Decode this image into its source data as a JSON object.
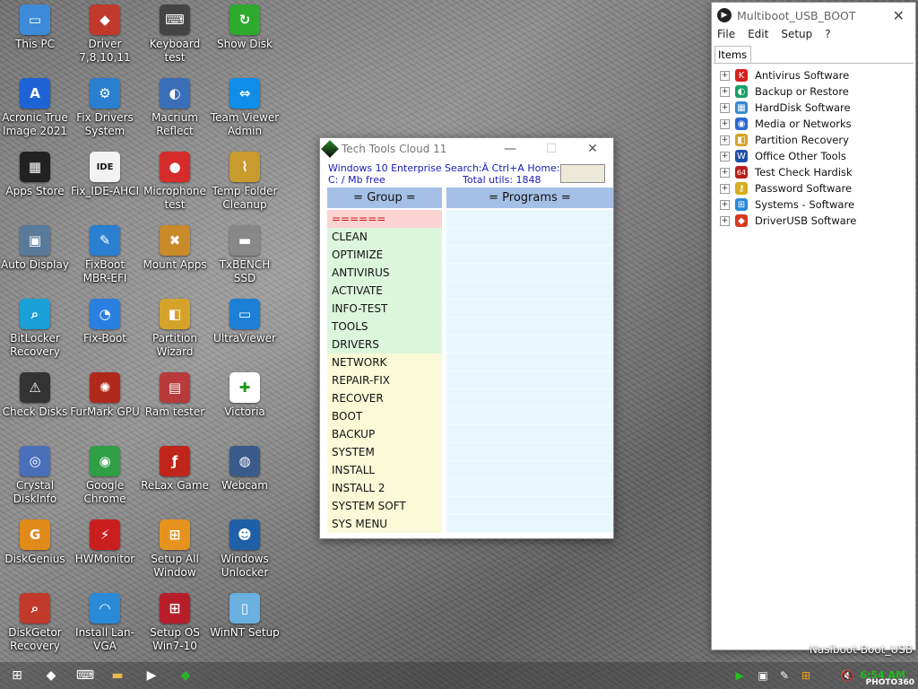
{
  "desktop": {
    "icons": [
      {
        "label": "This PC",
        "icon": "monitor-icon",
        "color": "#3d8bd8",
        "glyph": "▭"
      },
      {
        "label": "Driver 7,8,10,11",
        "icon": "driver-icon",
        "color": "#c0392b",
        "glyph": "◆"
      },
      {
        "label": "Keyboard test",
        "icon": "keyboard-icon",
        "color": "#444444",
        "glyph": "⌨"
      },
      {
        "label": "Show Disk",
        "icon": "refresh-icon",
        "color": "#2eaa2e",
        "glyph": "↻"
      },
      {
        "label": "Acronic True Image 2021",
        "icon": "acronis-icon",
        "color": "#1e63d6",
        "glyph": "A"
      },
      {
        "label": "Fix Drivers System",
        "icon": "gear-icon",
        "color": "#2a7fd0",
        "glyph": "⚙"
      },
      {
        "label": "Macrium Reflect",
        "icon": "macrium-icon",
        "color": "#3a6fb8",
        "glyph": "◐"
      },
      {
        "label": "Team Viewer Admin",
        "icon": "teamviewer-icon",
        "color": "#0e8ee9",
        "glyph": "⇔"
      },
      {
        "label": "Apps Store",
        "icon": "store-icon",
        "color": "#222222",
        "glyph": "▦"
      },
      {
        "label": "Fix_IDE-AHCI",
        "icon": "ahci-icon",
        "color": "#f2f2f2",
        "glyph": "IDE"
      },
      {
        "label": "Microphone test",
        "icon": "microphone-icon",
        "color": "#d62b2b",
        "glyph": "●"
      },
      {
        "label": "Temp Folder Cleanup",
        "icon": "broom-icon",
        "color": "#c99a2e",
        "glyph": "⌇"
      },
      {
        "label": "Auto Display",
        "icon": "display-icon",
        "color": "#5a7a9a",
        "glyph": "▣"
      },
      {
        "label": "FixBoot MBR-EFI",
        "icon": "wrench-icon",
        "color": "#2a7fd0",
        "glyph": "✎"
      },
      {
        "label": "Mount Apps",
        "icon": "tools-icon",
        "color": "#c98a2a",
        "glyph": "✖"
      },
      {
        "label": "TxBENCH SSD",
        "icon": "ssd-icon",
        "color": "#888888",
        "glyph": "▬"
      },
      {
        "label": "BitLocker Recovery",
        "icon": "magnifier-icon",
        "color": "#1aa0d6",
        "glyph": "⌕"
      },
      {
        "label": "Fix-Boot",
        "icon": "pie-icon",
        "color": "#2a7fe0",
        "glyph": "◔"
      },
      {
        "label": "Partition Wizard",
        "icon": "partition-icon",
        "color": "#d6a32a",
        "glyph": "◧"
      },
      {
        "label": "UltraViewer",
        "icon": "ultraviewer-icon",
        "color": "#1d7fd6",
        "glyph": "▭"
      },
      {
        "label": "Check Disks",
        "icon": "warning-disk-icon",
        "color": "#333333",
        "glyph": "⚠"
      },
      {
        "label": "FurMark GPU",
        "icon": "furmark-icon",
        "color": "#b0281b",
        "glyph": "✺"
      },
      {
        "label": "Ram tester",
        "icon": "ram-icon",
        "color": "#b83a3a",
        "glyph": "▤"
      },
      {
        "label": "Victoria",
        "icon": "green-cross-icon",
        "color": "#ffffff",
        "glyph": "✚"
      },
      {
        "label": "Crystal DiskInfo",
        "icon": "crystal-icon",
        "color": "#4a6fb8",
        "glyph": "◎"
      },
      {
        "label": "Google Chrome",
        "icon": "chrome-icon",
        "color": "#2f9e44",
        "glyph": "◉"
      },
      {
        "label": "ReLax Game",
        "icon": "flash-icon",
        "color": "#c0251b",
        "glyph": "ƒ"
      },
      {
        "label": "Webcam",
        "icon": "webcam-icon",
        "color": "#3a5a8a",
        "glyph": "◍"
      },
      {
        "label": "DiskGenius",
        "icon": "diskgenius-icon",
        "color": "#e08a1a",
        "glyph": "G"
      },
      {
        "label": "HWMonitor",
        "icon": "hwmonitor-icon",
        "color": "#c81e1e",
        "glyph": "⚡"
      },
      {
        "label": "Setup All Window",
        "icon": "windows-orange-icon",
        "color": "#e6931e",
        "glyph": "⊞"
      },
      {
        "label": "Windows Unlocker",
        "icon": "users-icon",
        "color": "#1e5fa8",
        "glyph": "☻"
      },
      {
        "label": "DiskGetor Recovery",
        "icon": "disk-search-icon",
        "color": "#c0392b",
        "glyph": "⌕"
      },
      {
        "label": "Install Lan-VGA",
        "icon": "wifi-icon",
        "color": "#2a8ad8",
        "glyph": "◠"
      },
      {
        "label": "Setup OS Win7-10",
        "icon": "windows-red-icon",
        "color": "#b81e2a",
        "glyph": "⊞"
      },
      {
        "label": "WinNT Setup",
        "icon": "winnt-icon",
        "color": "#6ab0e0",
        "glyph": "▯"
      }
    ]
  },
  "tech_tools": {
    "title": "Tech Tools Cloud 11",
    "minimize": "—",
    "maximize": "☐",
    "close": "✕",
    "os_line": "Windows 10 Enterprise",
    "drive_line": "C:  /  Mb  free",
    "search_line": "Search:Â Ctrl+A Home:",
    "total_line": "Total utils: 1848",
    "group_header": "= Group =",
    "programs_header": "= Programs  =",
    "groups": [
      {
        "label": "======",
        "bg": "#fbd3d3",
        "color": "#cc1111"
      },
      {
        "label": "CLEAN",
        "bg": "#dcf6dc",
        "color": "#111111"
      },
      {
        "label": "OPTIMIZE",
        "bg": "#dcf6dc",
        "color": "#111111"
      },
      {
        "label": "ANTIVIRUS",
        "bg": "#dcf6dc",
        "color": "#111111"
      },
      {
        "label": "ACTIVATE",
        "bg": "#dcf6dc",
        "color": "#111111"
      },
      {
        "label": "INFO-TEST",
        "bg": "#dcf6dc",
        "color": "#111111"
      },
      {
        "label": "TOOLS",
        "bg": "#dcf6dc",
        "color": "#111111"
      },
      {
        "label": "DRIVERS",
        "bg": "#dcf6dc",
        "color": "#111111"
      },
      {
        "label": "NETWORK",
        "bg": "#fbfad8",
        "color": "#111111"
      },
      {
        "label": "REPAIR-FIX",
        "bg": "#fbfad8",
        "color": "#111111"
      },
      {
        "label": "RECOVER",
        "bg": "#fbfad8",
        "color": "#111111"
      },
      {
        "label": "BOOT",
        "bg": "#fbfad8",
        "color": "#111111"
      },
      {
        "label": "BACKUP",
        "bg": "#fbfad8",
        "color": "#111111"
      },
      {
        "label": "SYSTEM",
        "bg": "#fbfad8",
        "color": "#111111"
      },
      {
        "label": "INSTALL",
        "bg": "#fbfad8",
        "color": "#111111"
      },
      {
        "label": "INSTALL 2",
        "bg": "#fbfad8",
        "color": "#111111"
      },
      {
        "label": "SYSTEM SOFT",
        "bg": "#fbfad8",
        "color": "#111111"
      },
      {
        "label": "SYS MENU",
        "bg": "#fbfad8",
        "color": "#111111"
      }
    ]
  },
  "multiboot": {
    "title": "Multiboot_USB_BOOT",
    "close": "✕",
    "menu": [
      "File",
      "Edit",
      "Setup",
      "?"
    ],
    "tab": "Items",
    "items": [
      {
        "label": "Antivirus Software",
        "icon": "antivirus-icon",
        "color": "#d61e1e",
        "glyph": "K"
      },
      {
        "label": "Backup or Restore",
        "icon": "backup-icon",
        "color": "#1aa06a",
        "glyph": "◐"
      },
      {
        "label": "HardDisk Software",
        "icon": "harddisk-icon",
        "color": "#3a8ad0",
        "glyph": "▦"
      },
      {
        "label": "Media or Networks",
        "icon": "network-icon",
        "color": "#2a6ad0",
        "glyph": "◉"
      },
      {
        "label": "Partition Recovery",
        "icon": "partition-recovery-icon",
        "color": "#d6a32a",
        "glyph": "◧"
      },
      {
        "label": "Office Other Tools",
        "icon": "word-icon",
        "color": "#1e4fa8",
        "glyph": "W"
      },
      {
        "label": "Test Check Hardisk",
        "icon": "aida64-icon",
        "color": "#b81e1e",
        "glyph": "64"
      },
      {
        "label": "Password Software",
        "icon": "key-icon",
        "color": "#d6b01e",
        "glyph": "⚷"
      },
      {
        "label": "Systems - Software",
        "icon": "windows-icon",
        "color": "#2a8ad8",
        "glyph": "⊞"
      },
      {
        "label": "DriverUSB Software",
        "icon": "driverusb-icon",
        "color": "#d63a1e",
        "glyph": "◆"
      }
    ]
  },
  "watermark": "Nasiboot-Boot_USB",
  "taskbar": {
    "items": [
      {
        "icon": "windows-start-icon",
        "glyph": "⊞"
      },
      {
        "icon": "driver-taskbar-icon",
        "glyph": "◆"
      },
      {
        "icon": "keyboard-taskbar-icon",
        "glyph": "⌨"
      },
      {
        "icon": "folder-icon",
        "glyph": "▬"
      },
      {
        "icon": "play-icon",
        "glyph": "▶"
      },
      {
        "icon": "techtools-taskbar-icon",
        "glyph": "◆"
      }
    ],
    "tray": [
      {
        "icon": "play-tray-icon",
        "glyph": "▶"
      },
      {
        "icon": "network-off-icon",
        "glyph": "▣"
      },
      {
        "icon": "tool-tray-icon",
        "glyph": "✎"
      },
      {
        "icon": "windows-tray-icon",
        "glyph": "⊞"
      },
      {
        "icon": "speaker-muted-icon",
        "glyph": "🔇"
      }
    ],
    "clock": "6:54 AM",
    "brand": "PHOTO360"
  }
}
